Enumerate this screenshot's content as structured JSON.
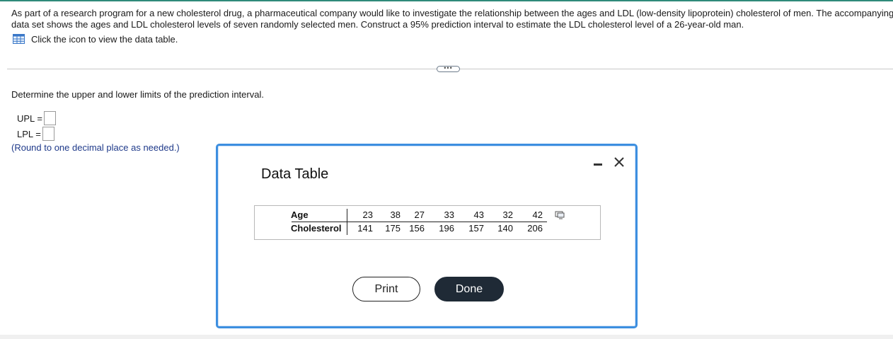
{
  "question": {
    "line1": "As part of a research program for a new cholesterol drug, a pharmaceutical company would like to investigate the relationship between the ages and LDL (low-density lipoprotein) cholesterol of men. The accompanying",
    "line2": "data set shows the ages and LDL cholesterol levels of seven randomly selected men. Construct a 95% prediction interval to estimate the LDL cholesterol level of a 26-year-old man."
  },
  "data_link": {
    "icon": "table-grid-icon",
    "label": "Click the icon to view the data table."
  },
  "expand_button": {
    "label": "•••"
  },
  "instruction": "Determine the upper and lower limits of the prediction interval.",
  "answers": {
    "upl_label": "UPL =",
    "lpl_label": "LPL =",
    "upl_value": "",
    "lpl_value": "",
    "round_note": "(Round to one decimal place as needed.)"
  },
  "dialog": {
    "title": "Data Table",
    "minimize_icon": "minimize-icon",
    "close_icon": "close-icon",
    "table": {
      "row_headers": [
        "Age",
        "Cholesterol"
      ],
      "age": [
        "23",
        "38",
        "27",
        "33",
        "43",
        "32",
        "42"
      ],
      "cholesterol": [
        "141",
        "175",
        "156",
        "196",
        "157",
        "140",
        "206"
      ]
    },
    "copy_icon": "copy-icon",
    "print_label": "Print",
    "done_label": "Done"
  },
  "colors": {
    "accent": "#3d8fe0",
    "done_button": "#1f2a36",
    "note_text": "#1f3a8a",
    "top_rule": "#2f8a7a"
  }
}
